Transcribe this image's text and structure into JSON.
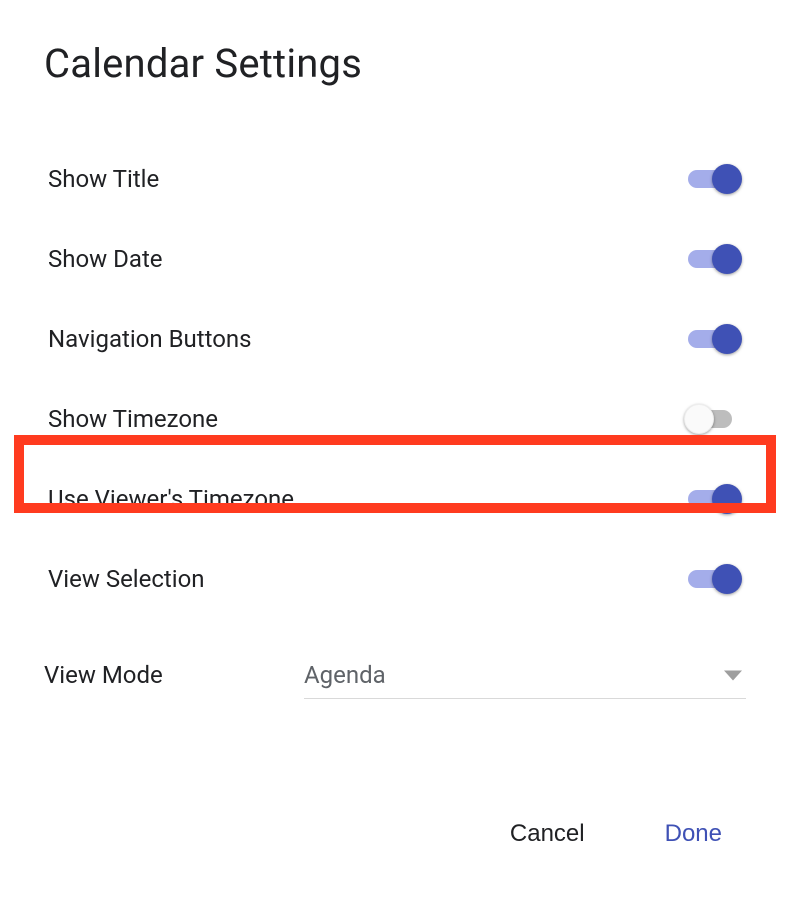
{
  "title": "Calendar Settings",
  "toggles": {
    "show_title": {
      "label": "Show Title",
      "on": true
    },
    "show_date": {
      "label": "Show Date",
      "on": true
    },
    "nav_buttons": {
      "label": "Navigation Buttons",
      "on": true
    },
    "show_tz": {
      "label": "Show Timezone",
      "on": false
    },
    "viewer_tz": {
      "label": "Use Viewer's Timezone",
      "on": true
    },
    "view_sel": {
      "label": "View Selection",
      "on": true
    }
  },
  "view_mode": {
    "label": "View Mode",
    "value": "Agenda"
  },
  "buttons": {
    "cancel": "Cancel",
    "done": "Done"
  },
  "colors": {
    "accent": "#3f51b5",
    "accent_track": "#a4adea",
    "off_track": "#bdbdbd",
    "highlight": "#ff3b1f"
  }
}
